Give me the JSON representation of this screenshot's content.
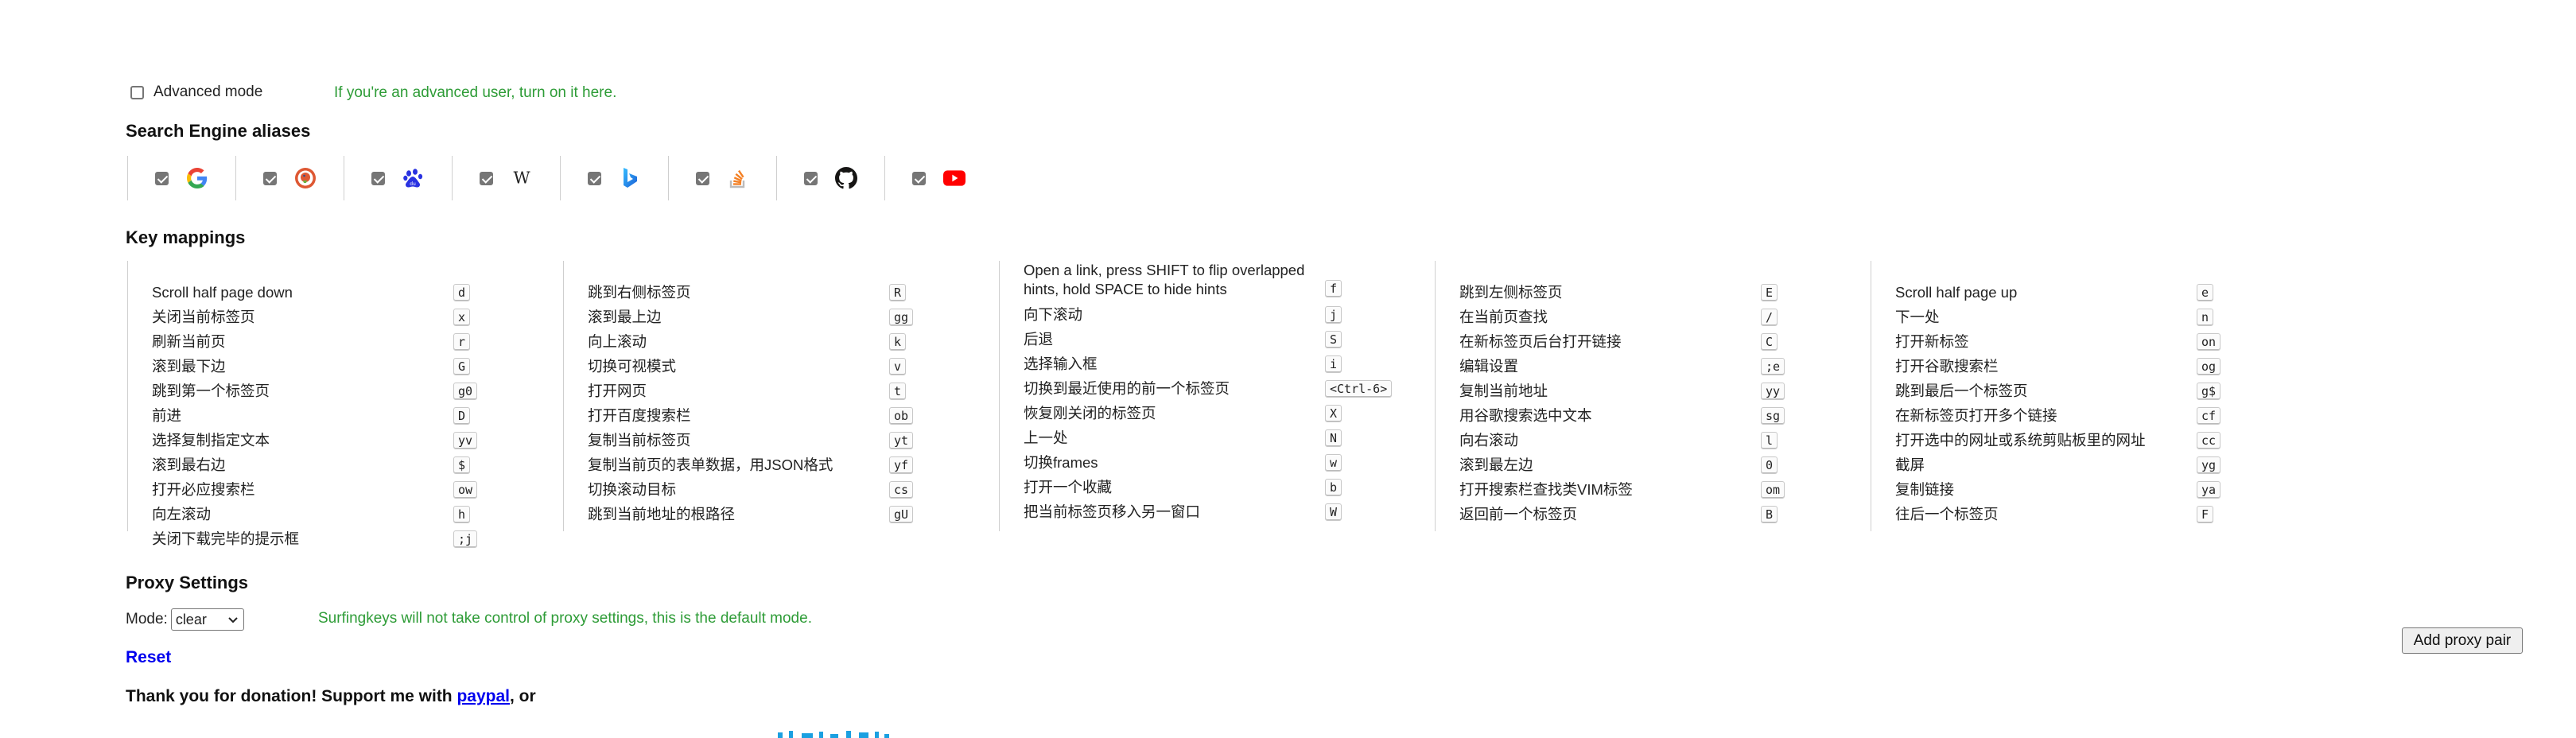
{
  "advanced": {
    "label": "Advanced mode",
    "checked": false,
    "hint": "If you're an advanced user, turn on it here."
  },
  "engines": {
    "title": "Search Engine aliases",
    "items": [
      {
        "name": "Google",
        "icon": "google-icon",
        "checked": true
      },
      {
        "name": "DuckDuckGo",
        "icon": "duckduckgo-icon",
        "checked": true
      },
      {
        "name": "Baidu",
        "icon": "baidu-icon",
        "checked": true
      },
      {
        "name": "Wikipedia",
        "icon": "wikipedia-icon",
        "checked": true
      },
      {
        "name": "Bing",
        "icon": "bing-icon",
        "checked": true
      },
      {
        "name": "Stack Overflow",
        "icon": "stackoverflow-icon",
        "checked": true
      },
      {
        "name": "GitHub",
        "icon": "github-icon",
        "checked": true
      },
      {
        "name": "YouTube",
        "icon": "youtube-icon",
        "checked": true
      }
    ]
  },
  "keymappings": {
    "title": "Key mappings",
    "columns": [
      [
        {
          "annotation": "Scroll half page down",
          "key": "d"
        },
        {
          "annotation": "关闭当前标签页",
          "key": "x"
        },
        {
          "annotation": "刷新当前页",
          "key": "r"
        },
        {
          "annotation": "滚到最下边",
          "key": "G"
        },
        {
          "annotation": "跳到第一个标签页",
          "key": "g0"
        },
        {
          "annotation": "前进",
          "key": "D"
        },
        {
          "annotation": "选择复制指定文本",
          "key": "yv"
        },
        {
          "annotation": "滚到最右边",
          "key": "$"
        },
        {
          "annotation": "打开必应搜索栏",
          "key": "ow"
        },
        {
          "annotation": "向左滚动",
          "key": "h"
        },
        {
          "annotation": "关闭下载完毕的提示框",
          "key": ";j"
        }
      ],
      [
        {
          "annotation": "跳到右侧标签页",
          "key": "R"
        },
        {
          "annotation": "滚到最上边",
          "key": "gg"
        },
        {
          "annotation": "向上滚动",
          "key": "k"
        },
        {
          "annotation": "切换可视模式",
          "key": "v"
        },
        {
          "annotation": "打开网页",
          "key": "t"
        },
        {
          "annotation": "打开百度搜索栏",
          "key": "ob"
        },
        {
          "annotation": "复制当前标签页",
          "key": "yt"
        },
        {
          "annotation": "复制当前页的表单数据，用JSON格式",
          "key": "yf"
        },
        {
          "annotation": "切换滚动目标",
          "key": "cs"
        },
        {
          "annotation": "跳到当前地址的根路径",
          "key": "gU"
        }
      ],
      [
        {
          "annotation": "Open a link, press SHIFT to flip overlapped hints, hold SPACE to hide hints",
          "key": "f",
          "tall": true
        },
        {
          "annotation": "向下滚动",
          "key": "j"
        },
        {
          "annotation": "后退",
          "key": "S"
        },
        {
          "annotation": "选择输入框",
          "key": "i"
        },
        {
          "annotation": "切换到最近使用的前一个标签页",
          "key": "<Ctrl-6>"
        },
        {
          "annotation": "恢复刚关闭的标签页",
          "key": "X"
        },
        {
          "annotation": "上一处",
          "key": "N"
        },
        {
          "annotation": "切换frames",
          "key": "w"
        },
        {
          "annotation": "打开一个收藏",
          "key": "b"
        },
        {
          "annotation": "把当前标签页移入另一窗口",
          "key": "W"
        }
      ],
      [
        {
          "annotation": "跳到左侧标签页",
          "key": "E"
        },
        {
          "annotation": "在当前页查找",
          "key": "/"
        },
        {
          "annotation": "在新标签页后台打开链接",
          "key": "C"
        },
        {
          "annotation": "编辑设置",
          "key": ";e"
        },
        {
          "annotation": "复制当前地址",
          "key": "yy"
        },
        {
          "annotation": "用谷歌搜索选中文本",
          "key": "sg"
        },
        {
          "annotation": "向右滚动",
          "key": "l"
        },
        {
          "annotation": "滚到最左边",
          "key": "0"
        },
        {
          "annotation": "打开搜索栏查找类VIM标签",
          "key": "om"
        },
        {
          "annotation": "返回前一个标签页",
          "key": "B"
        }
      ],
      [
        {
          "annotation": "Scroll half page up",
          "key": "e"
        },
        {
          "annotation": "下一处",
          "key": "n"
        },
        {
          "annotation": "打开新标签",
          "key": "on"
        },
        {
          "annotation": "打开谷歌搜索栏",
          "key": "og"
        },
        {
          "annotation": "跳到最后一个标签页",
          "key": "g$"
        },
        {
          "annotation": "在新标签页打开多个链接",
          "key": "cf"
        },
        {
          "annotation": "打开选中的网址或系统剪贴板里的网址",
          "key": "cc"
        },
        {
          "annotation": "截屏",
          "key": "yg"
        },
        {
          "annotation": "复制链接",
          "key": "ya"
        },
        {
          "annotation": "往后一个标签页",
          "key": "F"
        }
      ]
    ]
  },
  "proxy": {
    "title": "Proxy Settings",
    "mode_label": "Mode:",
    "mode_value": "clear",
    "mode_hint": "Surfingkeys will not take control of proxy settings, this is the default mode.",
    "add_button": "Add proxy pair"
  },
  "reset_label": "Reset",
  "donation": {
    "prefix": "Thank you for donation! Support me with ",
    "link": "paypal",
    "suffix": ", or"
  },
  "colors": {
    "hint_green": "#2e9c37",
    "link_blue": "#0000ee",
    "divider": "#cfcfcf"
  }
}
